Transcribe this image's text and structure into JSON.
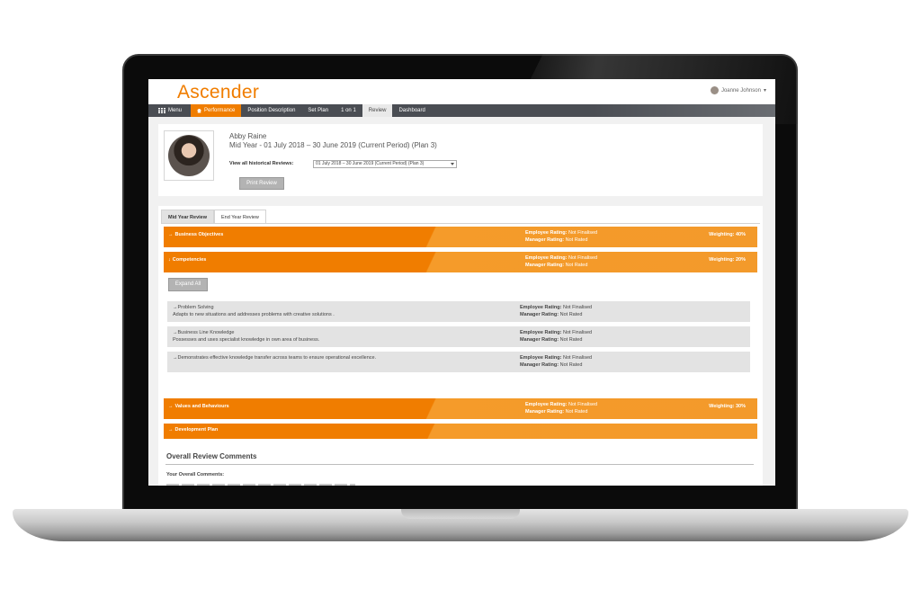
{
  "header": {
    "logo": "Ascender",
    "user_name": "Joanne Johnson",
    "user_caret": "▾"
  },
  "nav": {
    "items": [
      {
        "label": "Menu",
        "icon": "grid-icon"
      },
      {
        "label": "Performance",
        "icon": "home-icon"
      },
      {
        "label": "Position Description"
      },
      {
        "label": "Set Plan"
      },
      {
        "label": "1 on 1"
      },
      {
        "label": "Review"
      },
      {
        "label": "Dashboard"
      }
    ]
  },
  "profile": {
    "name": "Abby Raine",
    "period": "Mid Year - 01 July 2018 – 30 June 2019 (Current Period) (Plan 3)",
    "historical_label": "View all historical Reviews:",
    "historical_value": "01 July 2018 – 30 June 2019 (Current Period) (Plan 3)",
    "print_button": "Print Review"
  },
  "tabs": [
    "Mid Year Review",
    "End Year Review"
  ],
  "sections": [
    {
      "title": "Business Objectives",
      "emp_label": "Employee Rating:",
      "emp_value": "Not Finalised",
      "mgr_label": "Manager Rating:",
      "mgr_value": "Not Rated",
      "weighting": "Weighting: 40%"
    },
    {
      "title": "Competencies",
      "emp_label": "Employee Rating:",
      "emp_value": "Not Finalised",
      "mgr_label": "Manager Rating:",
      "mgr_value": "Not Rated",
      "weighting": "Weighting: 20%"
    },
    {
      "title": "Values and Behaviours",
      "emp_label": "Employee Rating:",
      "emp_value": "Not Finalised",
      "mgr_label": "Manager Rating:",
      "mgr_value": "Not Rated",
      "weighting": "Weighting: 30%"
    },
    {
      "title": "Development Plan"
    }
  ],
  "expand_all": "Expand All",
  "competencies": [
    {
      "name": "Problem Solving",
      "desc": "Adapts to new situations and addresses problems with creative solutions .",
      "emp_label": "Employee Rating:",
      "emp_value": "Not Finalised",
      "mgr_label": "Manager Rating:",
      "mgr_value": "Not Rated"
    },
    {
      "name": "Business Line Knowledge",
      "desc": "Possesses and uses specialist knowledge in own area of business.",
      "emp_label": "Employee Rating:",
      "emp_value": "Not Finalised",
      "mgr_label": "Manager Rating:",
      "mgr_value": "Not Rated"
    },
    {
      "name": "Demonstrates effective knowledge transfer across teams to ensure operational excellence.",
      "desc": "",
      "emp_label": "Employee Rating:",
      "emp_value": "Not Finalised",
      "mgr_label": "Manager Rating:",
      "mgr_value": "Not Rated"
    }
  ],
  "overall": {
    "title": "Overall Review Comments",
    "your_comments": "Your Overall Comments:"
  },
  "colors": {
    "accent": "#f07d00",
    "nav": "#4a4d53"
  }
}
